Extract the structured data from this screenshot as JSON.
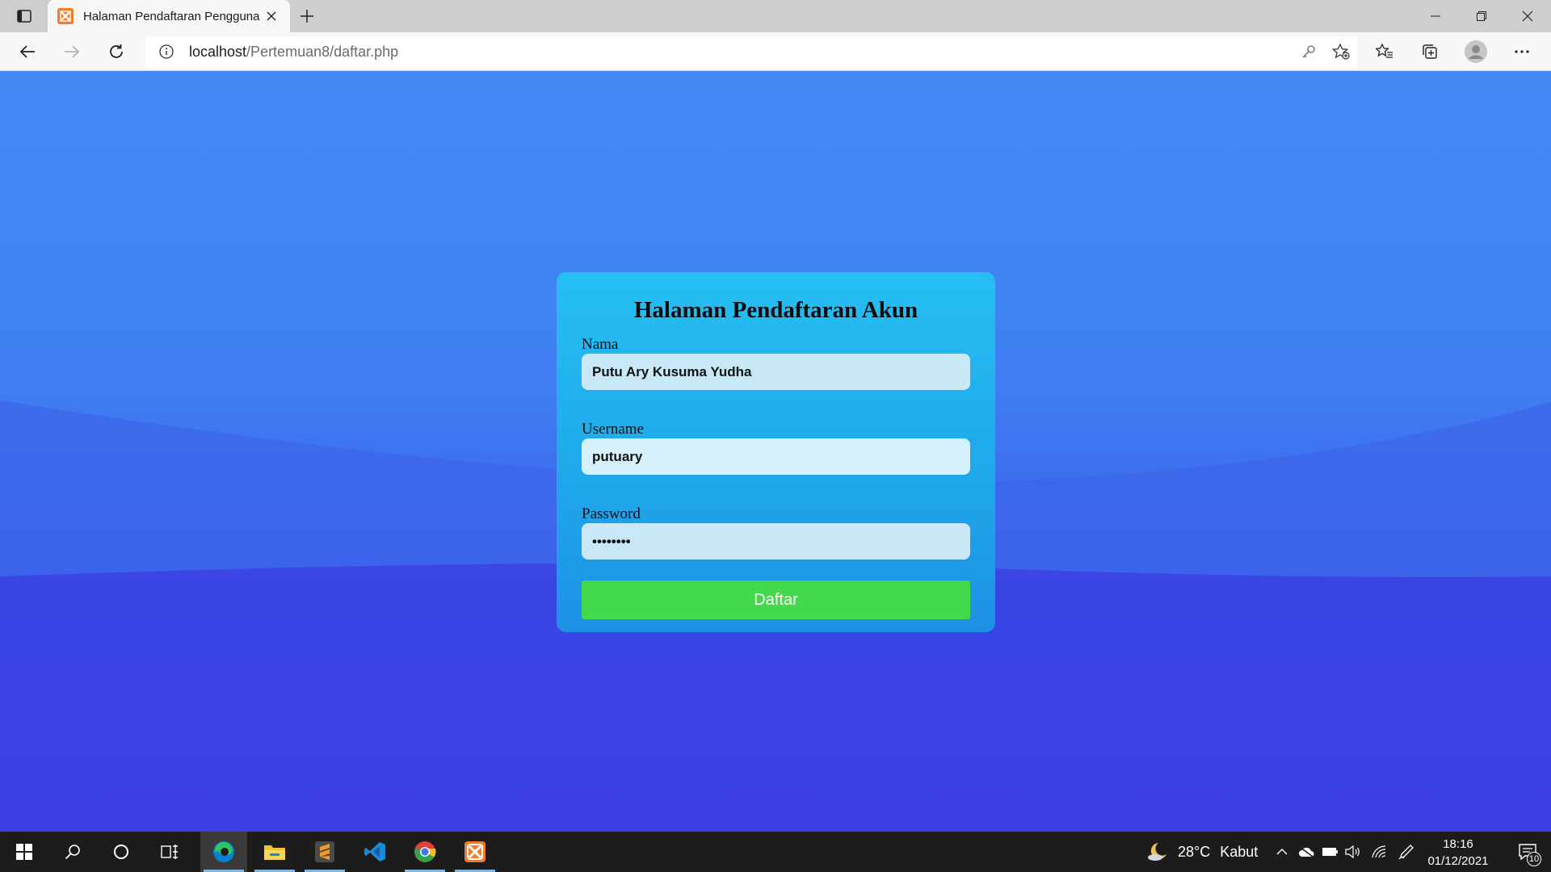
{
  "browser": {
    "tab_title": "Halaman Pendaftaran Pengguna",
    "url_host": "localhost",
    "url_path": "/Pertemuan8/daftar.php"
  },
  "form": {
    "title": "Halaman Pendaftaran Akun",
    "nama_label": "Nama",
    "nama_value": "Putu Ary Kusuma Yudha",
    "username_label": "Username",
    "username_value": "putuary",
    "password_label": "Password",
    "password_value": "putuary1",
    "submit_label": "Daftar"
  },
  "taskbar": {
    "apps": [
      "start-icon",
      "search-icon",
      "cortana-icon",
      "task-view-icon",
      "edge-icon",
      "file-explorer-icon",
      "sublime-text-icon",
      "vscode-icon",
      "chrome-icon",
      "xampp-icon"
    ],
    "weather_temp": "28°C",
    "weather_text": "Kabut",
    "time": "18:16",
    "date": "01/12/2021",
    "notification_count": "10"
  },
  "colors": {
    "submit_button": "#44d94c",
    "card": "#26bff2",
    "page_top": "#4488f4",
    "page_bottom": "#3a22df"
  }
}
